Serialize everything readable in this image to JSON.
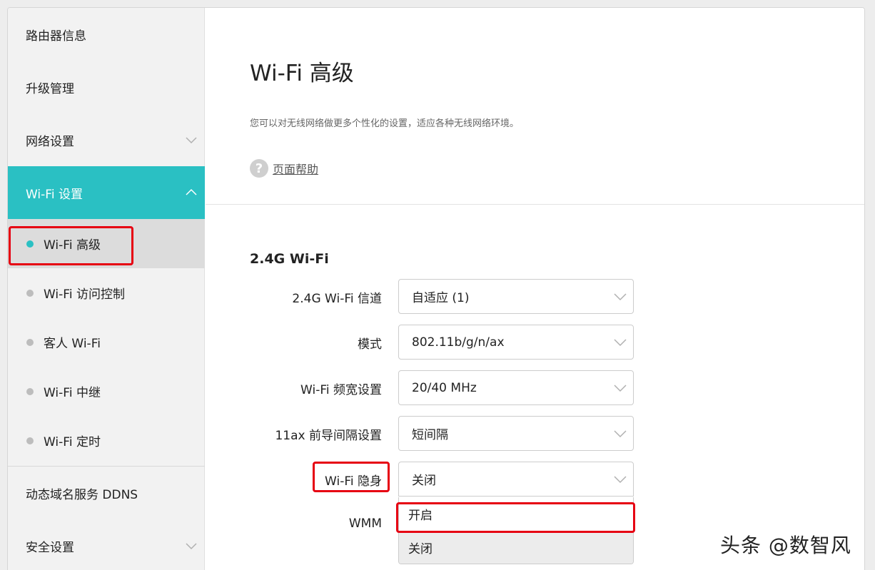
{
  "sidebar": {
    "items": [
      {
        "label": "路由器信息"
      },
      {
        "label": "升级管理"
      },
      {
        "label": "网络设置"
      },
      {
        "label": "Wi-Fi 设置"
      }
    ],
    "sub_items": [
      {
        "label": "Wi-Fi 高级"
      },
      {
        "label": "Wi-Fi 访问控制"
      },
      {
        "label": "客人 Wi-Fi"
      },
      {
        "label": "Wi-Fi 中继"
      },
      {
        "label": "Wi-Fi 定时"
      }
    ],
    "bottom_items": [
      {
        "label": "动态域名服务 DDNS"
      },
      {
        "label": "安全设置"
      }
    ]
  },
  "main": {
    "title": "Wi-Fi 高级",
    "description": "您可以对无线网络做更多个性化的设置，适应各种无线网络环境。",
    "help_link": "页面帮助",
    "help_icon_glyph": "?",
    "section_title": "2.4G Wi-Fi",
    "fields": [
      {
        "label": "2.4G Wi-Fi 信道",
        "value": "自适应 (1)"
      },
      {
        "label": "模式",
        "value": "802.11b/g/n/ax"
      },
      {
        "label": "Wi-Fi 频宽设置",
        "value": "20/40 MHz"
      },
      {
        "label": "11ax 前导间隔设置",
        "value": "短间隔"
      },
      {
        "label": "Wi-Fi 隐身",
        "value": "关闭"
      },
      {
        "label": "WMM"
      }
    ],
    "dropdown_options": [
      "开启",
      "关闭"
    ]
  },
  "watermark": "头条 @数智风",
  "colors": {
    "accent": "#2ac0c3",
    "highlight_box": "#e60012",
    "background": "#ededed"
  }
}
